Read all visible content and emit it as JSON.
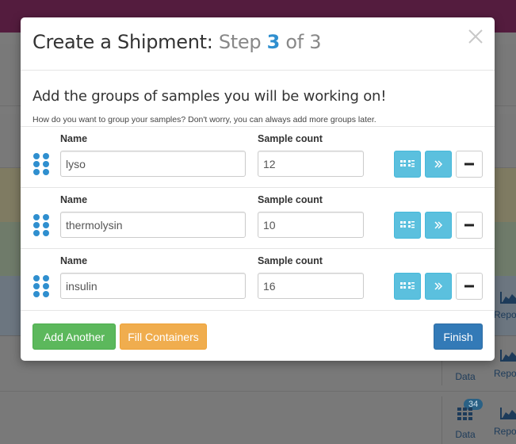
{
  "modal": {
    "title_main": "Create a Shipment:",
    "title_step_word": "Step",
    "title_step_num": "3",
    "title_of": "of 3",
    "heading": "Add the groups of samples you will be working on!",
    "help": "How do you want to group your samples? Don't worry, you can always add more groups later.",
    "label_name": "Name",
    "label_count": "Sample count",
    "groups": [
      {
        "name": "lyso",
        "count": "12"
      },
      {
        "name": "thermolysin",
        "count": "10"
      },
      {
        "name": "insulin",
        "count": "16"
      }
    ],
    "footer": {
      "add_label": "Add Another",
      "fill_label": "Fill Containers",
      "finish_label": "Finish"
    }
  },
  "background": {
    "data_label": "Data",
    "report_label": "Repo",
    "badge": "34"
  },
  "colors": {
    "accent": "#2f8fcf",
    "info": "#5bc0de",
    "success": "#5cb85c",
    "warning": "#f0ad4e",
    "primary": "#337ab7",
    "topbar": "#541c3e"
  },
  "icons": {
    "close": "close-icon",
    "drag": "drag-handle-icon",
    "grid": "grid-icon",
    "next": "double-chevron-right-icon",
    "remove": "minus-icon"
  }
}
